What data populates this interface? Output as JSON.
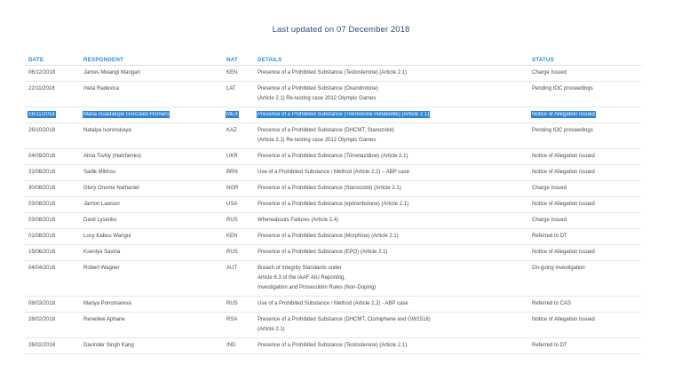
{
  "updated": "Last updated on 07 December 2018",
  "headers": {
    "date": "DATE",
    "respondent": "RESPONDENT",
    "nat": "NAT",
    "details": "DETAILS",
    "status": "STATUS"
  },
  "rows": [
    {
      "date": "06/12/2018",
      "respondent": "James Mwangi Wangari",
      "nat": "KEN",
      "details": [
        "Presence of a Prohibited Substance (Testosterone) (Article 2.1)"
      ],
      "status": "Charge Issued",
      "highlighted": false
    },
    {
      "date": "22/11/2018",
      "respondent": "Ineta Radevica",
      "nat": "LAT",
      "details": [
        "Presence of a Prohibited Substance (Oxandrolone)",
        "(Article 2.1) Re-testing case 2012 Olympic Games"
      ],
      "status": "Pending IOC proceedings",
      "highlighted": false
    },
    {
      "date": "16/11/2018",
      "respondent": "Maria Guadalupe Gonzalez-Romero",
      "nat": "MEX",
      "details": [
        "Presence of a Prohibited Substance (Trenbolone metabolite) (Article 2.1)"
      ],
      "status": "Notice of Allegation Issued",
      "highlighted": true
    },
    {
      "date": "26/10/2018",
      "respondent": "Natalya Ivoninskaya",
      "nat": "KAZ",
      "details": [
        "Presence of a Prohibited Substance (DHCMT, Stanozolol)",
        "(Article 2.1) Re-testing case 2012 Olympic Games"
      ],
      "status": "Pending IOC proceedings",
      "highlighted": false
    },
    {
      "date": "04/09/2018",
      "respondent": "Alina Tsviliy (Halchenko)",
      "nat": "UKR",
      "details": [
        "Presence of a Prohibited Substance (Trimetazidine) (Article 2.1)"
      ],
      "status": "Notice of Allegation Issued",
      "highlighted": false
    },
    {
      "date": "31/08/2018",
      "respondent": "Sadik Mikhou",
      "nat": "BRN",
      "details": [
        "Use of a Prohibited Substance / Method (Article 2.2) – ABP case"
      ],
      "status": "Notice of Allegation Issued",
      "highlighted": false
    },
    {
      "date": "30/08/2018",
      "respondent": "Glory Onome Nathaniel",
      "nat": "NGR",
      "details": [
        "Presence of a Prohibited Substance (Stanozolol) (Article 2.1)"
      ],
      "status": "Charge Issued",
      "highlighted": false
    },
    {
      "date": "03/08/2018",
      "respondent": "Jarrion Lawson",
      "nat": "USA",
      "details": [
        "Presence of a Prohibited Substance (epitrenbolone) (Article 2.1)"
      ],
      "status": "Notice of Allegation Issued",
      "highlighted": false
    },
    {
      "date": "03/08/2018",
      "respondent": "Danil Lysenko",
      "nat": "RUS",
      "details": [
        "Whereabouts Failures (Article 2.4)"
      ],
      "status": "Charge Issued",
      "highlighted": false
    },
    {
      "date": "01/08/2018",
      "respondent": "Lucy Kabuu Wangui",
      "nat": "KEN",
      "details": [
        "Presence of a Prohibited Substance (Morphine) (Article 2.1)"
      ],
      "status": "Referred to DT",
      "highlighted": false
    },
    {
      "date": "15/06/2018",
      "respondent": "Kseniya Savina",
      "nat": "RUS",
      "details": [
        "Presence of a Prohibited Substance (EPO) (Article 2.1)"
      ],
      "status": "Notice of Allegation Issued",
      "highlighted": false
    },
    {
      "date": "04/04/2018",
      "respondent": "Robert Wagner",
      "nat": "AUT",
      "details": [
        "Breach of Integrity Standards under",
        "Article 6.3 of the IAAF AIU  Reporting,",
        "Investigation and Prosecution Rules (Non-Doping)"
      ],
      "status": "On-going investigation",
      "highlighted": false
    },
    {
      "date": "08/03/2018",
      "respondent": "Mariya Ponomareva",
      "nat": "RUS",
      "details": [
        "Use of a Prohibited Substance / Method (Article 2.2) - ABP case"
      ],
      "status": "Referred to CAS",
      "highlighted": false
    },
    {
      "date": "28/02/2018",
      "respondent": "Reneilwe Aphane",
      "nat": "RSA",
      "details": [
        "Presence of a Prohibited Substance (DHCMT, Clomiphene and GW1516)",
        "(Article 2.1)"
      ],
      "status": "Notice of Allegation Issued",
      "highlighted": false
    },
    {
      "date": "26/02/2018",
      "respondent": "Davinder Singh Kang",
      "nat": "IND",
      "details": [
        "Presence of a Prohibited Substance (Testosterone) (Article 2.1)"
      ],
      "status": "Referred to DT",
      "highlighted": false
    }
  ]
}
